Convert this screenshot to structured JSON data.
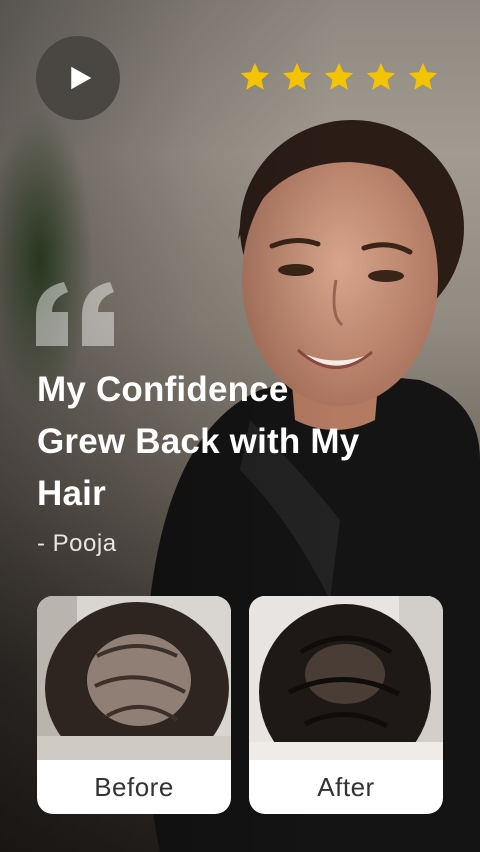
{
  "rating": {
    "stars": 5,
    "star_color": "#f5c400"
  },
  "testimonial": {
    "headline": "My Confidence Grew Back with My Hair",
    "author": "- Pooja"
  },
  "comparison": {
    "before_label": "Before",
    "after_label": "After"
  },
  "icons": {
    "play": "play-icon",
    "quote": "quote-icon",
    "star": "star-icon"
  }
}
